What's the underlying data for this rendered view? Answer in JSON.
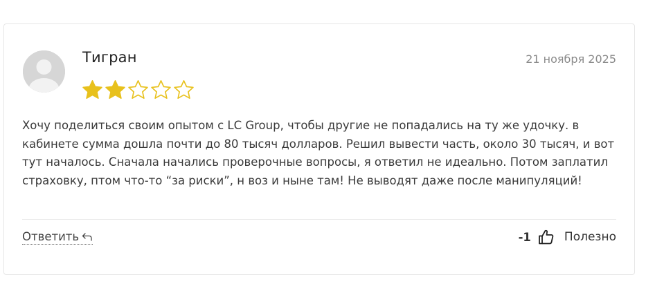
{
  "review": {
    "author": "Тигран",
    "date": "21 ноября 2025",
    "rating": 2,
    "rating_max": 5,
    "text": "Хочу поделиться своим опытом с LC Group, чтобы другие не попадались на ту же удочку. в кабинете сумма дошла почти до 80 тысяч долларов. Решил вывести часть, около 30 тысяч, и вот тут началось. Сначала начались проверочные вопросы, я ответил не идеально. Потом заплатил страховку, птом что-то “за риски”, н воз и ныне там! Не выводят даже после манипуляций!"
  },
  "actions": {
    "reply_label": "Ответить",
    "reply_icon": "reply-arrow-icon",
    "vote_count": "-1",
    "thumb_icon": "thumbs-up-icon",
    "helpful_label": "Полезно"
  },
  "colors": {
    "star_filled": "#e8c11c",
    "star_empty_stroke": "#e8c11c",
    "avatar_bg": "#d6d6d6",
    "avatar_fg": "#f2f2f2",
    "date": "#8a8a8a"
  }
}
